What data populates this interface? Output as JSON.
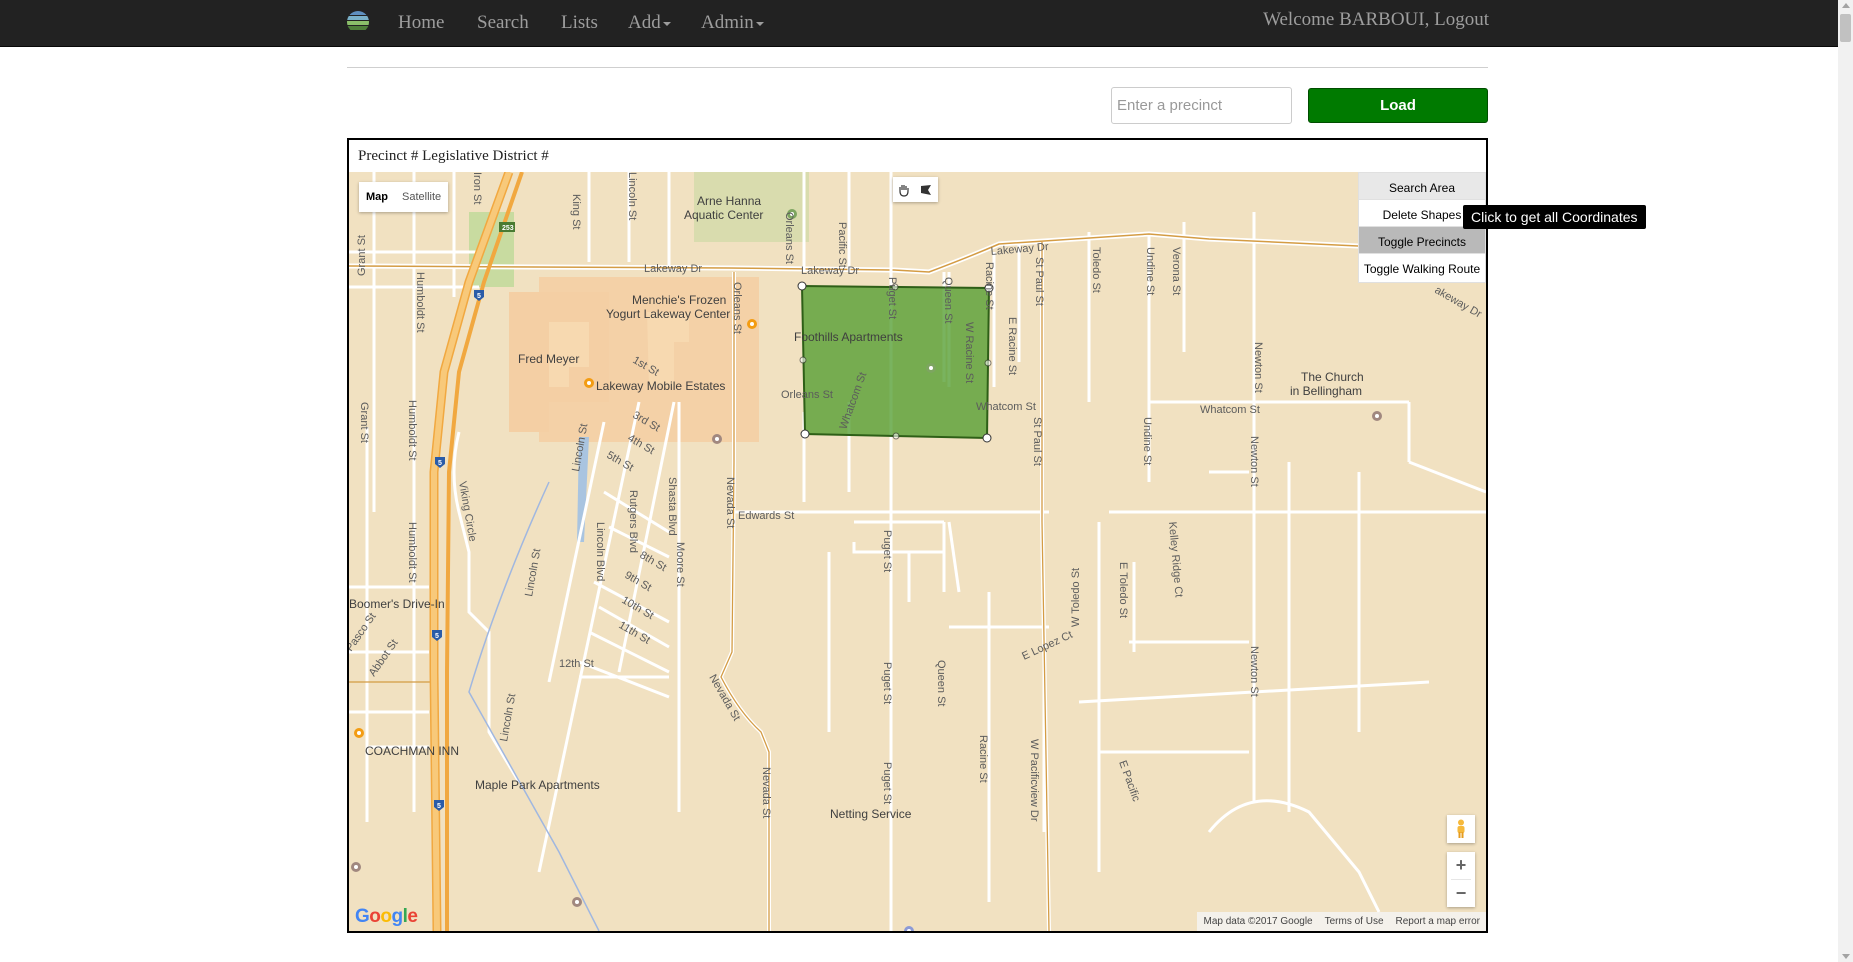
{
  "nav": {
    "home": "Home",
    "search": "Search",
    "lists": "Lists",
    "add": "Add",
    "admin": "Admin",
    "welcome": "Welcome BARBOUI, Logout"
  },
  "precinct_input": {
    "placeholder": "Enter a precinct",
    "value": ""
  },
  "load_button": "Load",
  "map_header": "Precinct # Legislative District #",
  "map_type": {
    "map": "Map",
    "satellite": "Satellite",
    "selected": "Map"
  },
  "map_controls": {
    "search_area": "Search Area",
    "delete_shapes": "Delete Shapes",
    "toggle_precincts": "Toggle Precincts",
    "toggle_walking_route": "Toggle Walking Route"
  },
  "tooltip": "Click to get all Coordinates",
  "attribution": {
    "map_data": "Map data ©2017 Google",
    "terms": "Terms of Use",
    "report": "Report a map error"
  },
  "google_logo": "Google",
  "colors": {
    "navbar_bg": "#222222",
    "load_button": "#007a00",
    "polygon_fill": "#4c9a2a",
    "map_bg": "#f1e1c1",
    "highway": "#f6bf5b"
  },
  "streets": {
    "lakeway_dr": "Lakeway Dr",
    "orleans_st": "Orleans St",
    "pacific_st": "Pacific St",
    "puget_st": "Puget St",
    "queen_st": "Queen St",
    "racine_st": "Racine St",
    "w_racine_st": "W Racine St",
    "e_racine_st": "E Racine St",
    "st_paul_st": "St Paul St",
    "toledo_st": "Toledo St",
    "undine_st": "Undine St",
    "verona_st": "Verona St",
    "newton_st": "Newton St",
    "whatcom_st": "Whatcom St",
    "nevada_st": "Nevada St",
    "edwards_st": "Edwards St",
    "lincoln_st": "Lincoln St",
    "lincoln_blvd": "Lincoln Blvd",
    "king_st": "King St",
    "iron_st": "Iron St",
    "grant_st": "Grant St",
    "humboldt_st": "Humboldt St",
    "viking_circle": "Viking Circle",
    "pasco_st": "Pasco St",
    "abbot_st": "Abbot St",
    "first_st": "1st St",
    "third_st": "3rd St",
    "fourth_st": "4th St",
    "fifth_st": "5th St",
    "eighth_st": "8th St",
    "ninth_st": "9th St",
    "tenth_st": "10th St",
    "eleventh_st": "11th St",
    "twelfth_st": "12th St",
    "rutgers_blvd": "Rutgers Blvd",
    "shasta_blvd": "Shasta Blvd",
    "moore_st": "Moore St",
    "e_toledo_st": "E Toledo St",
    "w_toledo_st": "W Toledo St",
    "e_lopez_ct": "E Lopez Ct",
    "kelley_ridge_ct": "Kelley Ridge Ct",
    "w_pacificview_dr": "W Pacificview Dr",
    "e_pacific": "E Pacific",
    "orleans_st_2": "Orleans St",
    "lakeway_dr_2": "Lakeway Dr",
    "lakeway_dr_3": "Lakeway Dr",
    "lakeway_dr_4": "akeway Dr",
    "humboldt_st_2": "Humboldt St",
    "humboldt_st_3": "Humboldt St",
    "grant_st_2": "Grant St",
    "racine_st_2": "Racine St",
    "st_paul_st_2": "St Paul St",
    "undine_st_2": "Undine St",
    "newton_st_2": "Newton St",
    "newton_st_3": "Newton St",
    "newton_st_4": "Newton St",
    "puget_st_2": "Puget St",
    "puget_st_3": "Puget St",
    "puget_st_4": "Puget St",
    "nevada_st_2": "Nevada St",
    "nevada_st_3": "Nevada St",
    "lincoln_st_2": "Lincoln St",
    "lincoln_st_3": "Lincoln St",
    "pacific_st_2": "Pacific St",
    "whatcom_st_2": "Whatcom St",
    "whatcom_st_3": "Whatcom St",
    "hwy_253": "253",
    "hwy_5": "5"
  },
  "pois": {
    "arne_hanna_1": "Arne Hanna",
    "arne_hanna_2": "Aquatic Center",
    "menchies_1": "Menchie's Frozen",
    "menchies_2": "Yogurt Lakeway Center",
    "fred_meyer": "Fred Meyer",
    "foothills": "Foothills Apartments",
    "lakeway_mobile": "Lakeway Mobile Estates",
    "church_1": "The Church",
    "church_2": "in Bellingham",
    "boomers": "Boomer's Drive-In",
    "coachman": "COACHMAN INN",
    "maple_park": "Maple Park Apartments",
    "netting": "Netting Service"
  }
}
